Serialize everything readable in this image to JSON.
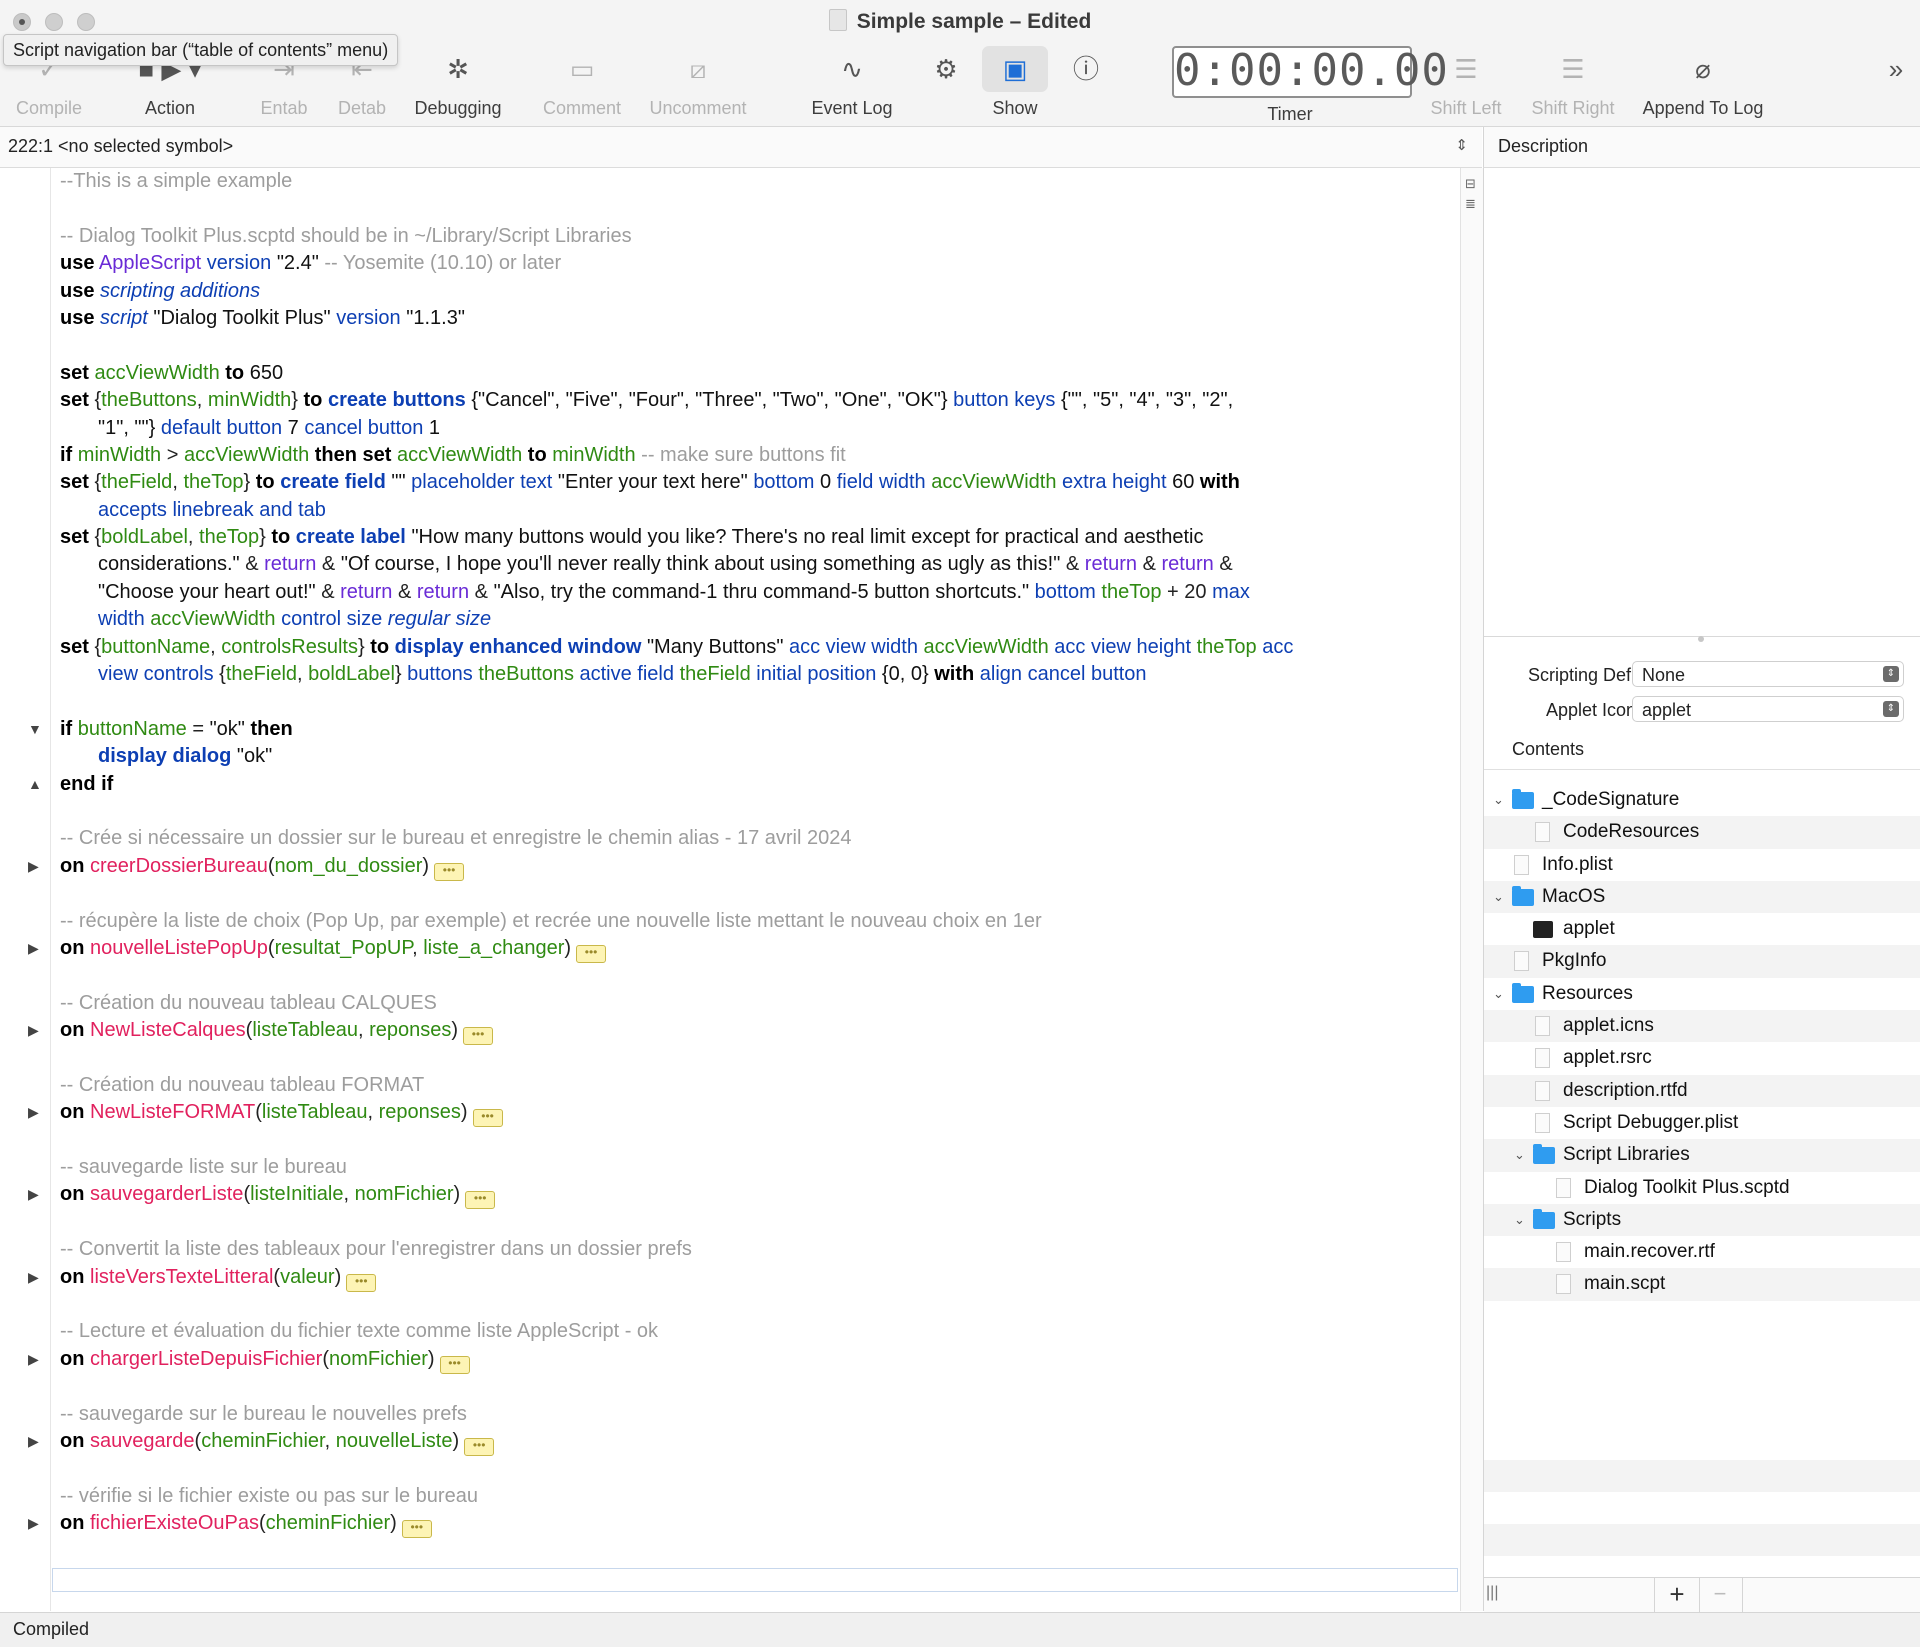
{
  "window": {
    "title": "Simple sample – Edited",
    "tooltip": "Script navigation bar (“table of contents” menu)"
  },
  "toolbar": {
    "compile": "Compile",
    "action": "Action",
    "entab": "Entab",
    "detab": "Detab",
    "debugging": "Debugging",
    "comment": "Comment",
    "uncomment": "Uncomment",
    "event_log": "Event Log",
    "show": "Show",
    "timer_label": "Timer",
    "timer_value": "0:00:00.00",
    "shift_left": "Shift Left",
    "shift_right": "Shift Right",
    "append_to_log": "Append To Log",
    "overflow": "»"
  },
  "navbar": {
    "position": "222:1  <no selected symbol>"
  },
  "description": {
    "header": "Description"
  },
  "properties": {
    "scripting_def_label": "Scripting Def.:",
    "scripting_def_value": "None",
    "applet_icon_label": "Applet Icon:",
    "applet_icon_value": "applet"
  },
  "contents": {
    "header": "Contents",
    "items": [
      "_CodeSignature",
      "CodeResources",
      "Info.plist",
      "MacOS",
      "applet",
      "PkgInfo",
      "Resources",
      "applet.icns",
      "applet.rsrc",
      "description.rtfd",
      "Script Debugger.plist",
      "Script Libraries",
      "Dialog Toolkit Plus.scptd",
      "Scripts",
      "main.recover.rtf",
      "main.scpt"
    ]
  },
  "status": {
    "text": "Compiled"
  },
  "code": {
    "t": {
      "use": "use",
      "set": "set",
      "to": "to",
      "if": "if",
      "then": "then",
      "with": "with",
      "on": "on",
      "end_if": "end if",
      "c_example": "--This is a simple example",
      "c_dtp": "-- Dialog Toolkit Plus.scptd should be in ~/Library/Script Libraries",
      "applescript": "AppleScript",
      "version": "version",
      "v24": "\"2.4\"",
      "c_yosemite": "-- Yosemite (10.10) or later",
      "scripting_additions": "scripting additions",
      "script": "script",
      "dtp_str": "\"Dialog Toolkit Plus\"",
      "v113": "\"1.1.3\"",
      "accViewWidth": "accViewWidth",
      "n650": "650",
      "theButtons": "theButtons",
      "minWidth": "minWidth",
      "create_buttons": "create buttons",
      "btn_list": "{\"Cancel\", \"Five\", \"Four\", \"Three\", \"Two\", \"One\", \"OK\"}",
      "button_keys": "button keys",
      "keys_a": "{\"\", \"5\", \"4\", \"3\", \"2\",",
      "keys_b": "\"1\", \"\"}",
      "default_button": "default button",
      "n7": "7",
      "cancel_button": "cancel button",
      "n1": "1",
      "gt": ">",
      "c_fit": "-- make sure buttons fit",
      "theField": "theField",
      "theTop": "theTop",
      "create_field": "create field",
      "empty_str": "\"\"",
      "placeholder_text": "placeholder text",
      "enter_str": "\"Enter your text here\"",
      "bottom": "bottom",
      "n0": "0",
      "field_width": "field width",
      "extra_height": "extra height",
      "n60": "60",
      "accepts": "accepts linebreak and tab",
      "boldLabel": "boldLabel",
      "create_label": "create label",
      "lbl1": "\"How many buttons would you like? There's no real limit except for practical and aesthetic",
      "lbl2": "considerations.\"",
      "amp": "&",
      "return": "return",
      "lbl3": "\"Of course, I hope you'll never really think about using something as ugly as this!\"",
      "lbl4": "\"Choose your heart out!\"",
      "lbl5": "\"Also, try the command-1 thru command-5 button shortcuts.\"",
      "plus20": "+ 20",
      "max": "max",
      "width": "width",
      "control_size": "control size",
      "regular_size": "regular size",
      "buttonName": "buttonName",
      "controlsResults": "controlsResults",
      "display_enhanced_window": "display enhanced window",
      "many_buttons": "\"Many Buttons\"",
      "acc_view_width": "acc view width",
      "acc_view_height": "acc view height",
      "acc": "acc",
      "view_controls": "view controls",
      "buttons": "buttons",
      "active_field": "active field",
      "initial_position": "initial position",
      "pos00": "{0, 0}",
      "align_cancel_button": "align cancel button",
      "eq": "=",
      "ok_str": "\"ok\"",
      "display_dialog": "display dialog",
      "c1": "-- Crée si nécessaire un dossier sur le bureau et enregistre le chemin alias - 17 avril 2024",
      "f1": "creerDossierBureau",
      "p1": "nom_du_dossier",
      "c2": "-- récupère la liste de choix (Pop Up, par exemple) et recrée une nouvelle liste mettant le nouveau choix en 1er",
      "f2": "nouvelleListePopUp",
      "p2a": "resultat_PopUP",
      "p2b": "liste_a_changer",
      "c3": "-- Création du nouveau tableau CALQUES",
      "f3": "NewListeCalques",
      "p3a": "listeTableau",
      "p3b": "reponses",
      "c4": "-- Création du nouveau tableau FORMAT",
      "f4": "NewListeFORMAT",
      "c5": "-- sauvegarde liste sur le bureau",
      "f5": "sauvegarderListe",
      "p5a": "listeInitiale",
      "p5b": "nomFichier",
      "c6": "-- Convertit la liste des tableaux pour l'enregistrer dans un dossier prefs",
      "f6": "listeVersTexteLitteral",
      "p6": "valeur",
      "c7": "-- Lecture et évaluation du fichier texte comme liste AppleScript - ok",
      "f7": "chargerListeDepuisFichier",
      "c8": "-- sauvegarde sur le bureau le nouvelles prefs",
      "f8": "sauvegarde",
      "p8a": "cheminFichier",
      "p8b": "nouvelleListe",
      "c9": "-- vérifie si le fichier existe ou pas sur le bureau",
      "f9": "fichierExisteOuPas",
      "ellipsis": "•••"
    }
  }
}
